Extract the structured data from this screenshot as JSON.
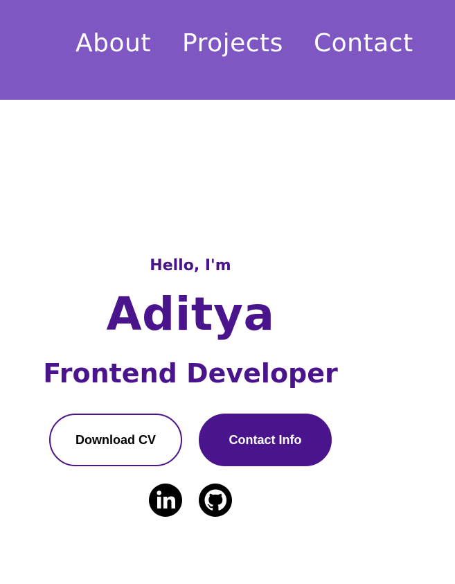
{
  "nav": {
    "links": [
      {
        "label": "About"
      },
      {
        "label": "Projects"
      },
      {
        "label": "Contact"
      }
    ],
    "background": "#7e57c2",
    "text_color": "#ffffff"
  },
  "hero": {
    "greeting": "Hello, I'm",
    "name": "Aditya",
    "role": "Frontend Developer",
    "accent_color": "#4a148c",
    "buttons": {
      "download_cv": "Download CV",
      "contact_info": "Contact Info"
    },
    "social": [
      {
        "icon": "linkedin-icon"
      },
      {
        "icon": "github-icon"
      }
    ]
  }
}
